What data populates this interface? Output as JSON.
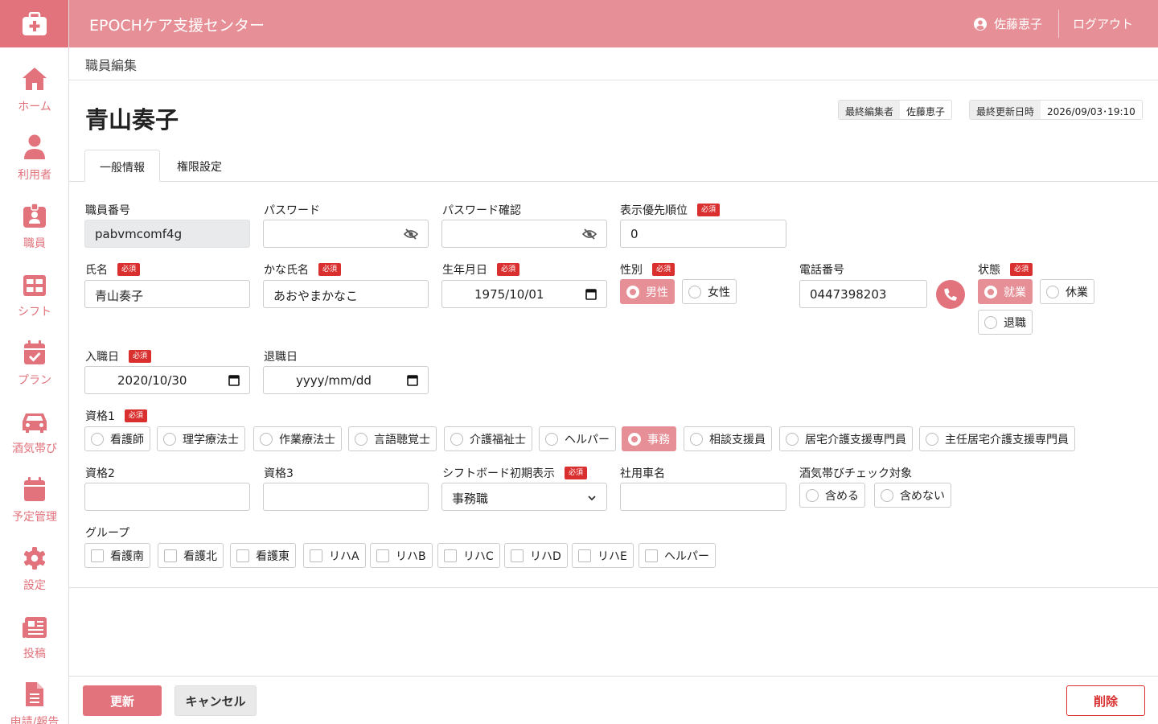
{
  "header": {
    "title": "EPOCHケア支援センター",
    "user": "佐藤恵子",
    "logout": "ログアウト"
  },
  "sidebar": {
    "items": [
      {
        "label": "ホーム",
        "icon": "home-icon"
      },
      {
        "label": "利用者",
        "icon": "person-icon"
      },
      {
        "label": "職員",
        "icon": "id-badge-icon"
      },
      {
        "label": "シフト",
        "icon": "grid-icon"
      },
      {
        "label": "プラン",
        "icon": "calendar-check-icon"
      },
      {
        "label": "酒気帯び",
        "icon": "car-icon"
      },
      {
        "label": "予定管理",
        "icon": "calendar-icon"
      },
      {
        "label": "設定",
        "icon": "gear-icon"
      },
      {
        "label": "投稿",
        "icon": "newspaper-icon"
      },
      {
        "label": "申請/報告",
        "icon": "document-icon"
      }
    ]
  },
  "breadcrumb": "職員編集",
  "page": {
    "title": "青山奏子",
    "last_editor_label": "最終編集者",
    "last_editor": "佐藤恵子",
    "last_updated_label": "最終更新日時",
    "last_updated": "2026/09/03･19:10"
  },
  "tabs": [
    "一般情報",
    "権限設定"
  ],
  "required_label": "必須",
  "form": {
    "staff_no": {
      "label": "職員番号",
      "value": "pabvmcomf4g"
    },
    "password": {
      "label": "パスワード",
      "value": ""
    },
    "password_confirm": {
      "label": "パスワード確認",
      "value": ""
    },
    "priority": {
      "label": "表示優先順位",
      "value": "0"
    },
    "name": {
      "label": "氏名",
      "value": "青山奏子"
    },
    "kana": {
      "label": "かな氏名",
      "value": "あおやまかなこ"
    },
    "birthday": {
      "label": "生年月日",
      "value": "1975/10/01"
    },
    "gender": {
      "label": "性別",
      "options": [
        "男性",
        "女性"
      ],
      "selected": "男性"
    },
    "phone": {
      "label": "電話番号",
      "value": "0447398203"
    },
    "status": {
      "label": "状態",
      "options": [
        "就業",
        "休業",
        "退職"
      ],
      "selected": "就業"
    },
    "hire_date": {
      "label": "入職日",
      "value": "2020/10/30"
    },
    "leave_date": {
      "label": "退職日",
      "placeholder": "yyyy/mm/dd"
    },
    "qualification1": {
      "label": "資格1",
      "options": [
        "看護師",
        "理学療法士",
        "作業療法士",
        "言語聴覚士",
        "介護福祉士",
        "ヘルパー",
        "事務",
        "相談支援員",
        "居宅介護支援専門員",
        "主任居宅介護支援専門員"
      ],
      "selected": "事務"
    },
    "qualification2": {
      "label": "資格2",
      "value": ""
    },
    "qualification3": {
      "label": "資格3",
      "value": ""
    },
    "shift_board": {
      "label": "シフトボード初期表示",
      "value": "事務職"
    },
    "company_car": {
      "label": "社用車名",
      "value": ""
    },
    "alcohol_check": {
      "label": "酒気帯びチェック対象",
      "options": [
        "含める",
        "含めない"
      ],
      "selected": ""
    },
    "group": {
      "label": "グループ",
      "options": [
        "看護南",
        "看護北",
        "看護東",
        "リハA",
        "リハB",
        "リハC",
        "リハD",
        "リハE",
        "ヘルパー"
      ]
    }
  },
  "footer": {
    "update": "更新",
    "cancel": "キャンセル",
    "delete": "削除"
  },
  "colors": {
    "accent": "#e2737c",
    "header": "#e68f96",
    "required": "#d9302f"
  }
}
